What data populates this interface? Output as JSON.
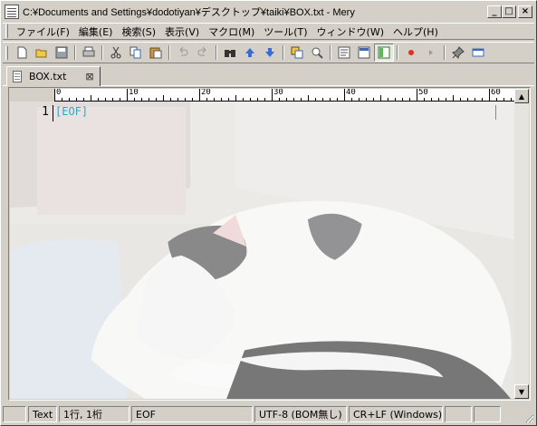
{
  "window": {
    "title": "C:¥Documents and Settings¥dodotiyan¥デスクトップ¥taiki¥BOX.txt - Mery",
    "minimize": "_",
    "maximize": "□",
    "close": "×"
  },
  "menu": [
    {
      "label": "ファイル(F)"
    },
    {
      "label": "編集(E)"
    },
    {
      "label": "検索(S)"
    },
    {
      "label": "表示(V)"
    },
    {
      "label": "マクロ(M)"
    },
    {
      "label": "ツール(T)"
    },
    {
      "label": "ウィンドウ(W)"
    },
    {
      "label": "ヘルプ(H)"
    }
  ],
  "toolbar": {
    "icons": [
      "new-file-icon",
      "open-folder-icon",
      "save-icon",
      "print-icon",
      "cut-icon",
      "copy-icon",
      "paste-icon",
      "undo-icon",
      "redo-icon",
      "find-icon",
      "find-up-icon",
      "find-down-icon",
      "replace-icon",
      "preview-icon",
      "word-wrap-icon",
      "ruler-icon",
      "outline-icon",
      "record-macro-icon",
      "play-macro-icon",
      "pin-icon",
      "window-icon"
    ]
  },
  "tab": {
    "label": "BOX.txt",
    "close": "⊠"
  },
  "editor": {
    "line_number": "1",
    "eof_marker": "[EOF]",
    "ruler_labels": [
      "0",
      "10",
      "20",
      "30",
      "40",
      "50",
      "60"
    ]
  },
  "status": {
    "mode": "Text",
    "position": "1行, 1桁",
    "eof": "EOF",
    "encoding": "UTF-8 (BOM無し)",
    "line_ending": "CR+LF (Windows)"
  }
}
